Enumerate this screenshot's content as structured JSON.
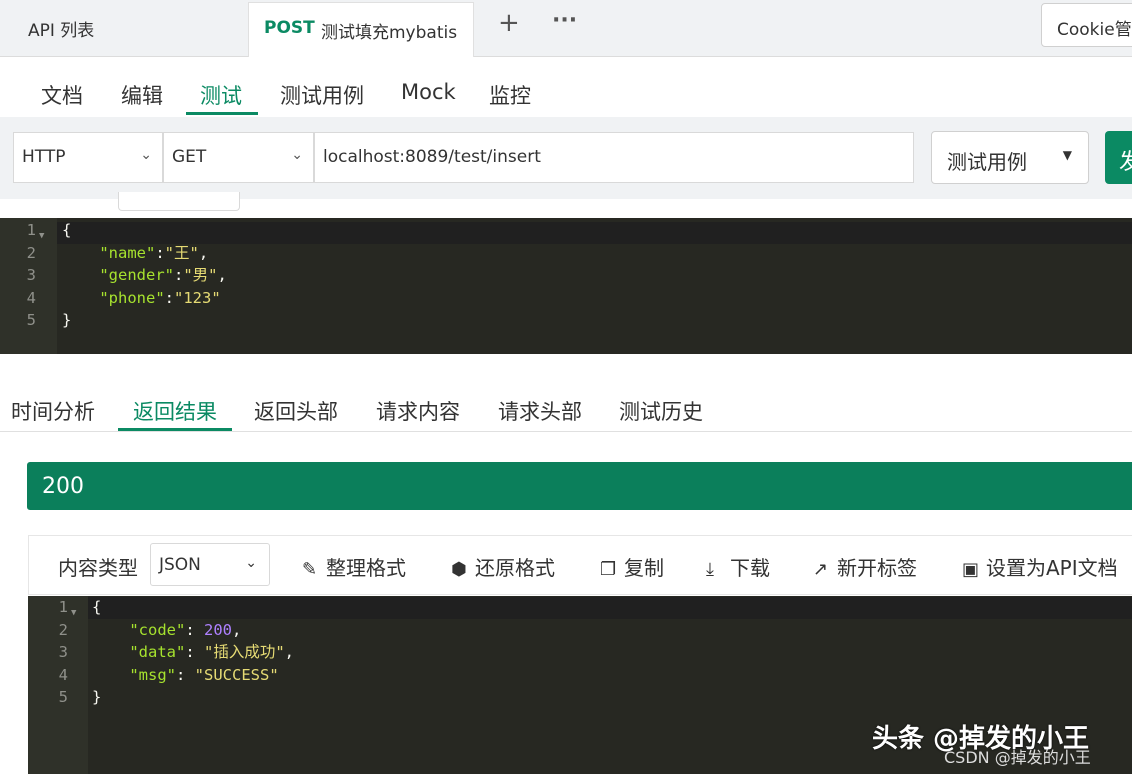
{
  "top_tabs": {
    "api_list": "API 列表",
    "active_method": "POST",
    "active_title": "测试填充mybatis",
    "add": "+",
    "more": "···",
    "cookie": "Cookie管理"
  },
  "sub_tabs": [
    "文档",
    "编辑",
    "测试",
    "测试用例",
    "Mock",
    "监控"
  ],
  "request": {
    "protocol": "HTTP",
    "method": "GET",
    "url": "localhost:8089/test/insert",
    "case_select": "测试用例",
    "send_label": "发送"
  },
  "request_body": {
    "line_numbers": [
      "1",
      "2",
      "3",
      "4",
      "5"
    ],
    "lines": [
      [
        {
          "t": "{",
          "c": "p"
        }
      ],
      [
        {
          "t": "    "
        },
        {
          "t": "\"name\"",
          "c": "k"
        },
        {
          "t": ":",
          "c": "p"
        },
        {
          "t": "\"王\"",
          "c": "s"
        },
        {
          "t": ",",
          "c": "p"
        }
      ],
      [
        {
          "t": "    "
        },
        {
          "t": "\"gender\"",
          "c": "k"
        },
        {
          "t": ":",
          "c": "p"
        },
        {
          "t": "\"男\"",
          "c": "s"
        },
        {
          "t": ",",
          "c": "p"
        }
      ],
      [
        {
          "t": "    "
        },
        {
          "t": "\"phone\"",
          "c": "k"
        },
        {
          "t": ":",
          "c": "p"
        },
        {
          "t": "\"123\"",
          "c": "s"
        }
      ],
      [
        {
          "t": "}",
          "c": "p"
        }
      ]
    ]
  },
  "response_tabs": [
    "时间分析",
    "返回结果",
    "返回头部",
    "请求内容",
    "请求头部",
    "测试历史"
  ],
  "status_code": "200",
  "toolbar": {
    "content_type_label": "内容类型",
    "content_type_value": "JSON",
    "format": "整理格式",
    "restore": "还原格式",
    "copy": "复制",
    "download": "下载",
    "new_tab": "新开标签",
    "set_api_doc": "设置为API文档"
  },
  "response_body": {
    "line_numbers": [
      "1",
      "2",
      "3",
      "4",
      "5"
    ],
    "lines": [
      [
        {
          "t": "{",
          "c": "p"
        }
      ],
      [
        {
          "t": "    "
        },
        {
          "t": "\"code\"",
          "c": "k"
        },
        {
          "t": ": ",
          "c": "p"
        },
        {
          "t": "200",
          "c": "n"
        },
        {
          "t": ",",
          "c": "p"
        }
      ],
      [
        {
          "t": "    "
        },
        {
          "t": "\"data\"",
          "c": "k"
        },
        {
          "t": ": ",
          "c": "p"
        },
        {
          "t": "\"插入成功\"",
          "c": "s"
        },
        {
          "t": ",",
          "c": "p"
        }
      ],
      [
        {
          "t": "    "
        },
        {
          "t": "\"msg\"",
          "c": "k"
        },
        {
          "t": ": ",
          "c": "p"
        },
        {
          "t": "\"SUCCESS\"",
          "c": "s"
        }
      ],
      [
        {
          "t": "}",
          "c": "p"
        }
      ]
    ]
  },
  "watermark": {
    "main": "头条 @掉发的小王",
    "sub": "CSDN @掉发的小王"
  },
  "colors": {
    "accent": "#0b8a63",
    "status_bg": "#0b7f5b",
    "editor_bg": "#272822"
  }
}
